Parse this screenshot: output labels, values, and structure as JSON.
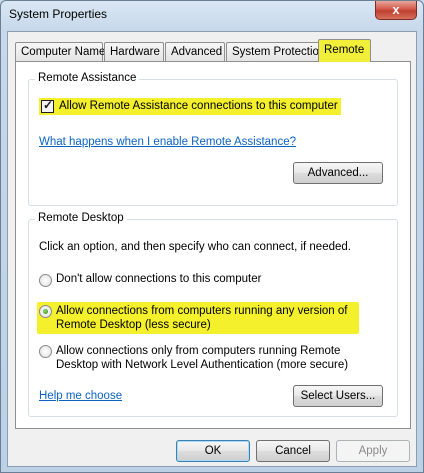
{
  "window": {
    "title": "System Properties",
    "close_label": "x"
  },
  "tabs": [
    {
      "label": "Computer Name"
    },
    {
      "label": "Hardware"
    },
    {
      "label": "Advanced"
    },
    {
      "label": "System Protection"
    },
    {
      "label": "Remote"
    }
  ],
  "remote_assistance": {
    "legend": "Remote Assistance",
    "allow_checkbox_label": "Allow Remote Assistance connections to this computer",
    "allow_checked": true,
    "help_link": "What happens when I enable Remote Assistance?",
    "advanced_button": "Advanced..."
  },
  "remote_desktop": {
    "legend": "Remote Desktop",
    "instruction": "Click an option, and then specify who can connect, if needed.",
    "option_dont_allow": "Don't allow connections to this computer",
    "option_any_version_line1": "Allow connections from computers running any version of",
    "option_any_version_line2": "Remote Desktop (less secure)",
    "option_nla_line1": "Allow connections only from computers running Remote",
    "option_nla_line2": "Desktop with Network Level Authentication (more secure)",
    "selected_option": "any_version",
    "help_link": "Help me choose",
    "select_users_button": "Select Users..."
  },
  "footer": {
    "ok": "OK",
    "cancel": "Cancel",
    "apply": "Apply"
  },
  "colors": {
    "highlight": "#f4f02c",
    "link": "#0b63c5",
    "active_tab": "#f1ef3a"
  }
}
